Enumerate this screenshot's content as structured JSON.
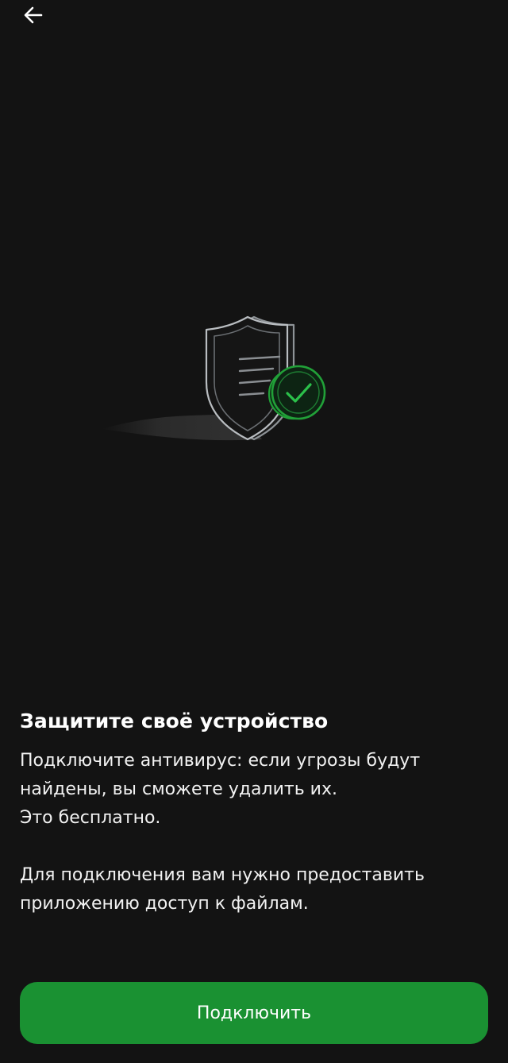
{
  "icons": {
    "back": "arrow-left-icon",
    "illustration": "shield-check-icon"
  },
  "colors": {
    "background": "#131313",
    "accent": "#1a9132",
    "check": "#21a038"
  },
  "content": {
    "title": "Защитите своё устройство",
    "paragraph1": "Подключите антивирус: если угрозы будут\nнайдены, вы сможете удалить их.\nЭто бесплатно.",
    "paragraph2": "Для подключения вам нужно предоставить\nприложению доступ к файлам."
  },
  "actions": {
    "connect_label": "Подключить"
  }
}
